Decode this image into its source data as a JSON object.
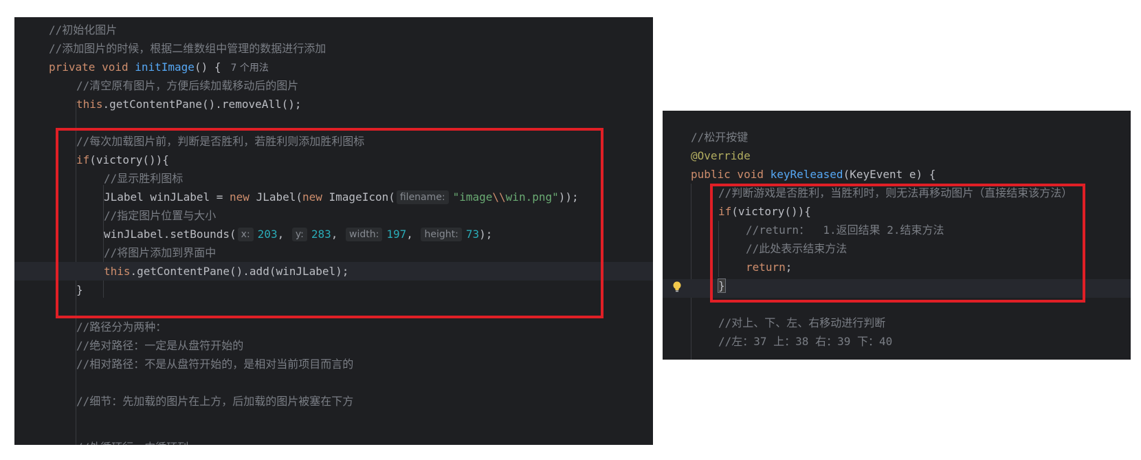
{
  "left_editor": {
    "lines": [
      [
        {
          "c": "cm",
          "t": "//初始化图片"
        }
      ],
      [
        {
          "c": "cm",
          "t": "//添加图片的时候，根据二维数组中管理的数据进行添加"
        }
      ],
      [
        {
          "c": "kw",
          "t": "private void "
        },
        {
          "c": "fn",
          "t": "initImage"
        },
        {
          "c": "plain",
          "t": "() {"
        },
        {
          "c": "hint",
          "t": "7 个用法"
        }
      ],
      [
        {
          "c": "cm",
          "t": "//清空原有图片，方便后续加载移动后的图片"
        }
      ],
      [
        {
          "c": "kw",
          "t": "this"
        },
        {
          "c": "plain",
          "t": ".getContentPane().removeAll();"
        }
      ],
      [],
      [
        {
          "c": "cm",
          "t": "//每次加载图片前，判断是否胜利，若胜利则添加胜利图标"
        }
      ],
      [
        {
          "c": "kw",
          "t": "if"
        },
        {
          "c": "plain",
          "t": "(victory()){"
        }
      ],
      [
        {
          "c": "cm",
          "t": "//显示胜利图标"
        }
      ],
      [
        {
          "c": "plain",
          "t": "JLabel winJLabel = "
        },
        {
          "c": "kw",
          "t": "new "
        },
        {
          "c": "plain",
          "t": "JLabel("
        },
        {
          "c": "kw",
          "t": "new "
        },
        {
          "c": "plain",
          "t": "ImageIcon("
        },
        {
          "c": "ph",
          "t": "filename:"
        },
        {
          "c": "str",
          "t": "\"image"
        },
        {
          "c": "esc",
          "t": "\\\\"
        },
        {
          "c": "str",
          "t": "win.png\""
        },
        {
          "c": "plain",
          "t": "));"
        }
      ],
      [
        {
          "c": "cm",
          "t": "//指定图片位置与大小"
        }
      ],
      [
        {
          "c": "plain",
          "t": "winJLabel.setBounds("
        },
        {
          "c": "ph",
          "t": "x:"
        },
        {
          "c": "num",
          "t": "203"
        },
        {
          "c": "plain",
          "t": ", "
        },
        {
          "c": "ph",
          "t": "y:"
        },
        {
          "c": "num",
          "t": "283"
        },
        {
          "c": "plain",
          "t": ", "
        },
        {
          "c": "ph",
          "t": "width:"
        },
        {
          "c": "num",
          "t": "197"
        },
        {
          "c": "plain",
          "t": ", "
        },
        {
          "c": "ph",
          "t": "height:"
        },
        {
          "c": "num",
          "t": "73"
        },
        {
          "c": "plain",
          "t": ");"
        }
      ],
      [
        {
          "c": "cm",
          "t": "//将图片添加到界面中"
        }
      ],
      [
        {
          "c": "kw",
          "t": "this"
        },
        {
          "c": "plain",
          "t": ".getContentPane().add(winJLabel);"
        }
      ],
      [
        {
          "c": "plain",
          "t": "}"
        }
      ],
      [],
      [
        {
          "c": "cm",
          "t": "//路径分为两种："
        }
      ],
      [
        {
          "c": "cm",
          "t": "//绝对路径：一定是从盘符开始的"
        }
      ],
      [
        {
          "c": "cm",
          "t": "//相对路径：不是从盘符开始的，是相对当前项目而言的"
        }
      ],
      [],
      [
        {
          "c": "cm",
          "t": "//细节：先加载的图片在上方，后加载的图片被塞在下方"
        }
      ],
      [],
      [
        {
          "c": "cm",
          "t": "//外循环行，内循环列"
        }
      ]
    ]
  },
  "right_editor": {
    "lines": [
      [
        {
          "c": "cm",
          "t": "//松开按键"
        }
      ],
      [
        {
          "c": "ann",
          "t": "@Override"
        }
      ],
      [
        {
          "c": "kw",
          "t": "public void "
        },
        {
          "c": "fn",
          "t": "keyReleased"
        },
        {
          "c": "plain",
          "t": "(KeyEvent e) {"
        }
      ],
      [
        {
          "c": "cm",
          "t": "//判断游戏是否胜利，当胜利时，则无法再移动图片（直接结束该方法）"
        }
      ],
      [
        {
          "c": "kw",
          "t": "if"
        },
        {
          "c": "plain",
          "t": "(victory())"
        },
        {
          "c": "brace",
          "t": "{"
        }
      ],
      [
        {
          "c": "cm",
          "t": "//return：  1.返回结果 2.结束方法"
        }
      ],
      [
        {
          "c": "cm",
          "t": "//此处表示结束方法"
        }
      ],
      [
        {
          "c": "kw",
          "t": "return"
        },
        {
          "c": "plain",
          "t": ";"
        }
      ],
      [
        {
          "c": "caret",
          "t": "}"
        }
      ],
      [],
      [
        {
          "c": "cm",
          "t": "//对上、下、左、右移动进行判断"
        }
      ],
      [
        {
          "c": "cm",
          "t": "//左：37 上：38 右：39 下：40"
        }
      ]
    ]
  },
  "colors": {
    "editor_bg": "#1e1f22",
    "current_line": "#26282e",
    "highlight_box": "#e01f26",
    "comment": "#7a7e85",
    "keyword": "#cf8e6d",
    "function": "#56a8f5",
    "string": "#6aab73",
    "number": "#2aacb8",
    "annotation": "#b3ae60"
  },
  "icons": {
    "intention_bulb": "lightbulb-icon"
  }
}
